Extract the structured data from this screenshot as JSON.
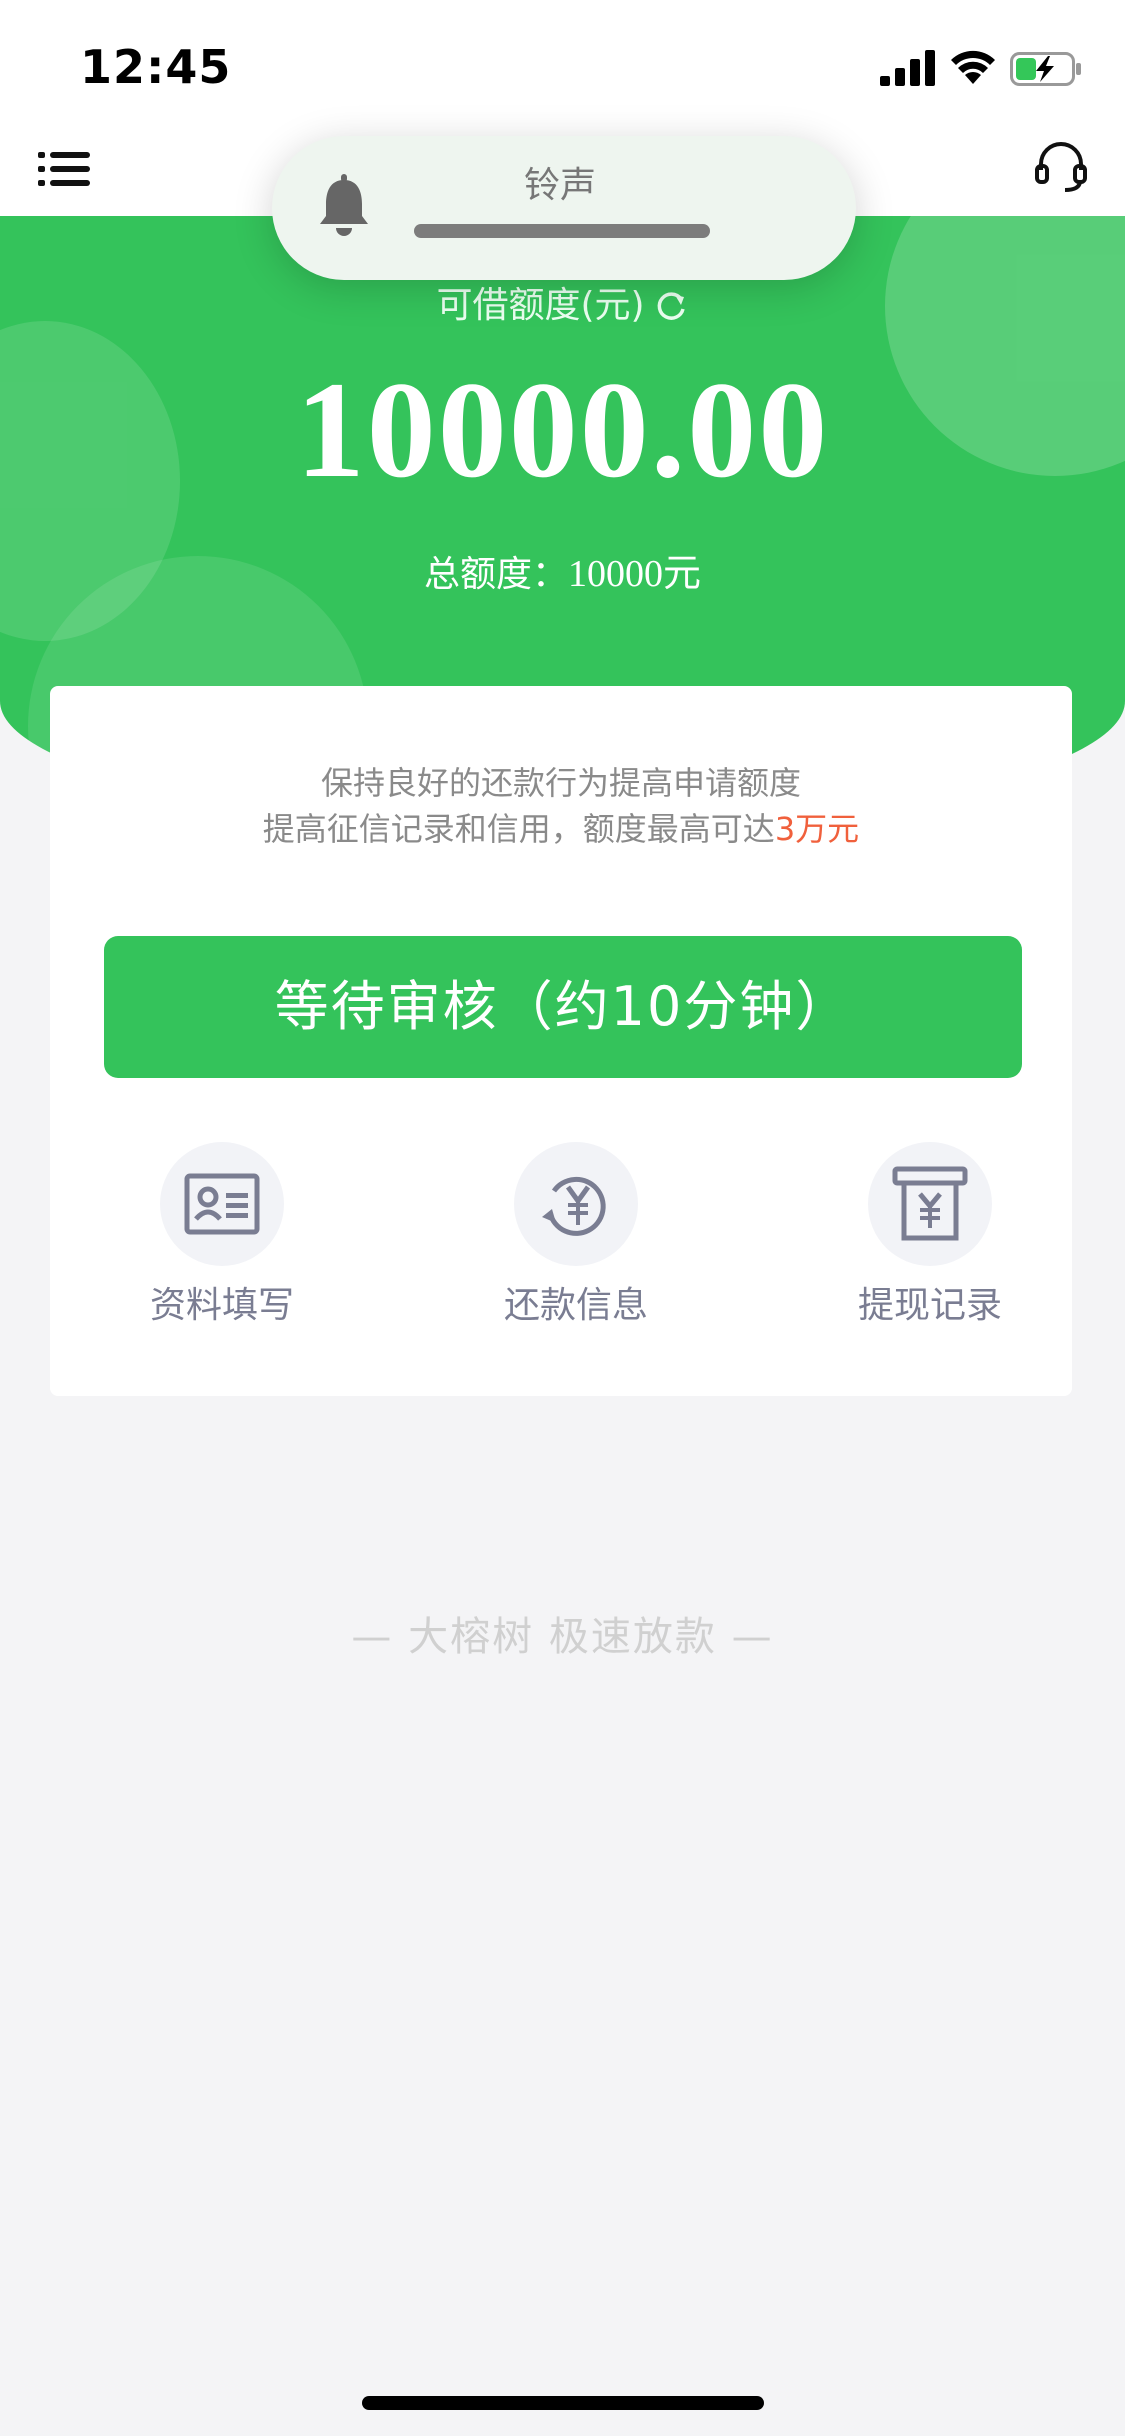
{
  "status_bar": {
    "time": "12:45"
  },
  "notification": {
    "title": "铃声",
    "icon": "bell-icon"
  },
  "hero": {
    "credit_label": "可借额度(元)",
    "amount": "10000.00",
    "total_label": "总额度：",
    "total_value": "10000元"
  },
  "card": {
    "tip_line1": "保持良好的还款行为提高申请额度",
    "tip_line2_prefix": "提高征信记录和信用，额度最高可达",
    "tip_line2_highlight": "3万元",
    "main_button": "等待审核（约10分钟）",
    "quick_actions": [
      {
        "label": "资料填写",
        "icon": "id-card-icon"
      },
      {
        "label": "还款信息",
        "icon": "yuan-repay-icon"
      },
      {
        "label": "提现记录",
        "icon": "withdraw-record-icon"
      }
    ]
  },
  "footer": {
    "slogan": "— 大榕树  极速放款 —"
  },
  "colors": {
    "brand_green": "#34c35b",
    "highlight_orange": "#f0603c",
    "icon_gray": "#7a7d92"
  }
}
